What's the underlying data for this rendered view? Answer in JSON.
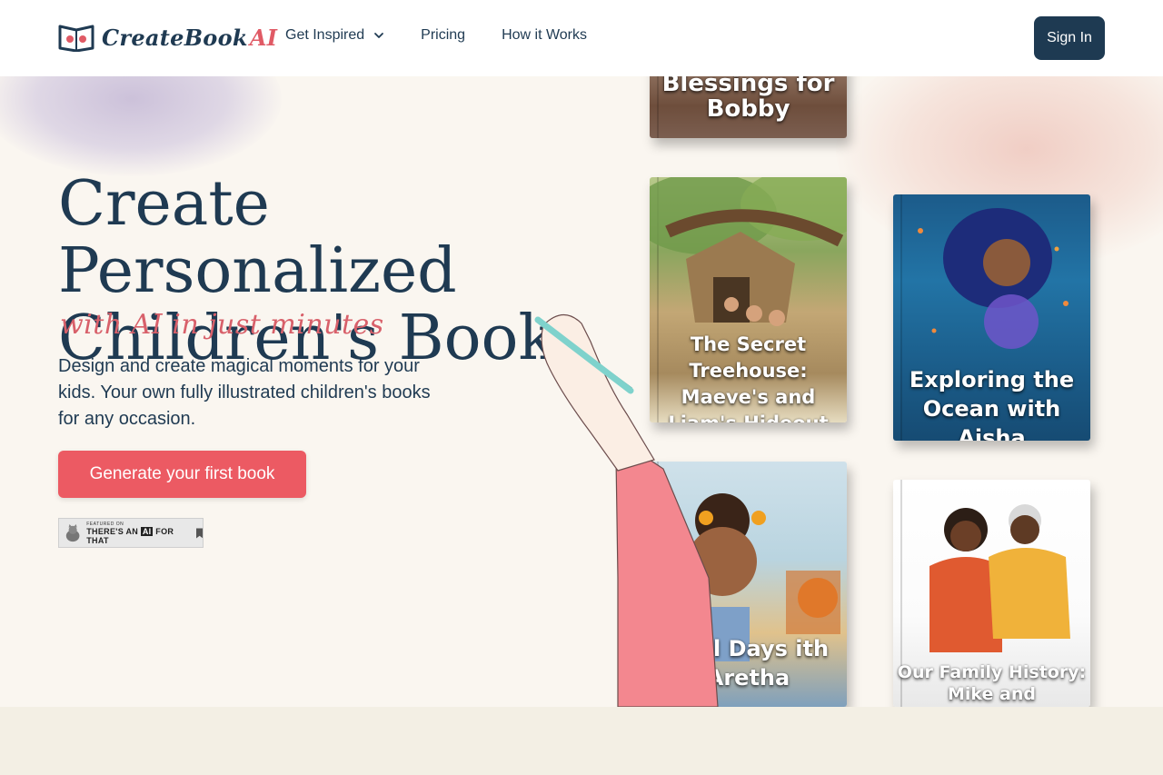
{
  "header": {
    "logo": {
      "brand": "CreateBook",
      "accent": "AI"
    },
    "nav": [
      {
        "label": "Get Inspired",
        "has_dropdown": true
      },
      {
        "label": "Pricing"
      },
      {
        "label": "How it Works"
      }
    ],
    "signin_label": "Sign In"
  },
  "hero": {
    "title_line1": "Create Personalized",
    "title_line2": "Children's Book",
    "tagline": "with AI in just minutes",
    "description": "Design and create magical moments for your kids. Your own  fully illustrated children's books for any occasion.",
    "cta_label": "Generate your first book",
    "badge": {
      "small": "FEATURED ON",
      "text_before": "THERE'S AN",
      "ai": "AI",
      "text_after": "FOR THAT"
    }
  },
  "books": [
    {
      "title": "Blessings for Bobby"
    },
    {
      "title": "The Secret Treehouse: Maeve's and Liam's Hideout"
    },
    {
      "title": "Exploring the Ocean with Aisha"
    },
    {
      "title": "hool Days ith Aretha"
    },
    {
      "title": "Our Family History: Mike and Grandparents"
    }
  ],
  "colors": {
    "primary": "#1e3a52",
    "accent": "#ec5a63",
    "tagline": "#d8606a",
    "hero_bg": "#faf6f0",
    "page_bg": "#f3efe4"
  },
  "icons": [
    "book-logo-icon",
    "chevron-down-icon",
    "cat-icon",
    "bookmark-icon"
  ]
}
